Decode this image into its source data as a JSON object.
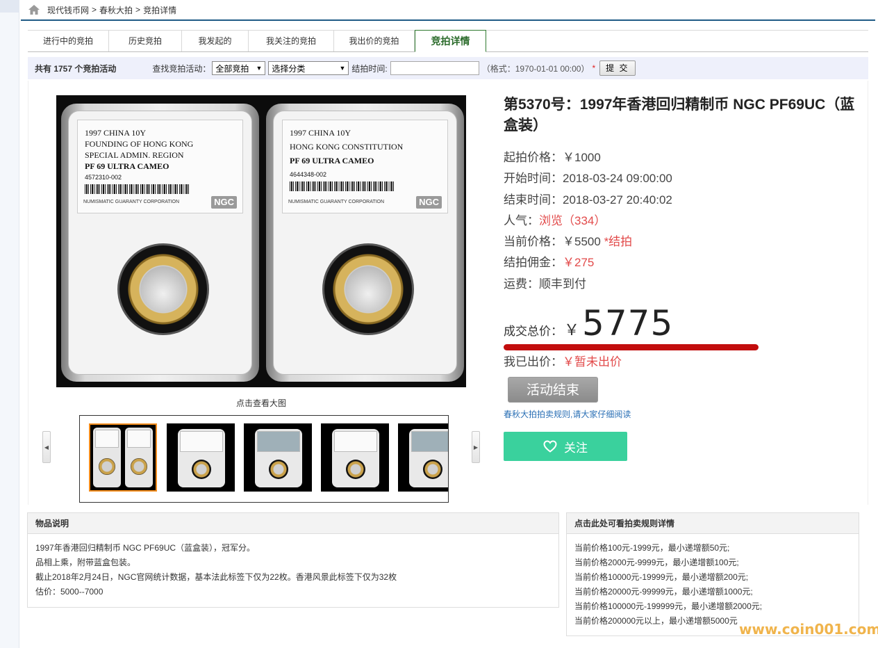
{
  "breadcrumb": {
    "items": [
      "现代钱币网",
      "春秋大拍",
      "竞拍详情"
    ],
    "separator": ">"
  },
  "tabs": [
    {
      "label": "进行中的竞拍",
      "active": false
    },
    {
      "label": "历史竞拍",
      "active": false
    },
    {
      "label": "我发起的",
      "active": false
    },
    {
      "label": "我关注的竞拍",
      "active": false
    },
    {
      "label": "我出价的竞拍",
      "active": false
    },
    {
      "label": "竞拍详情",
      "active": true
    }
  ],
  "filter": {
    "count_text": "共有 1757 个竞拍活动",
    "search_label": "查找竞拍活动：",
    "select_all": "全部竞拍",
    "select_category": "选择分类",
    "end_time_label": "结拍时间:",
    "end_time_value": "",
    "format_hint": "（格式：1970-01-01 00:00）",
    "required_mark": "*",
    "submit": "提 交"
  },
  "photo": {
    "slab_left": {
      "line1": "1997 CHINA 10Y",
      "line2": "FOUNDING OF HONG KONG",
      "line3": "SPECIAL ADMIN. REGION",
      "grade": "PF 69 ULTRA CAMEO",
      "cert": "4572310-002",
      "corp": "NUMISMATIC GUARANTY CORPORATION",
      "logo": "NGC"
    },
    "slab_right": {
      "line1": "1997 CHINA 10Y",
      "line2": "HONG KONG CONSTITUTION",
      "line3": "",
      "grade": "PF 69 ULTRA CAMEO",
      "cert": "4644348-002",
      "corp": "NUMISMATIC GUARANTY CORPORATION",
      "logo": "NGC"
    },
    "caption": "点击查看大图"
  },
  "item": {
    "title": "第5370号：1997年香港回归精制币 NGC PF69UC（蓝盒装）",
    "start_price_label": "起拍价格：",
    "start_price": "￥1000",
    "start_time_label": "开始时间：",
    "start_time": "2018-03-24 09:00:00",
    "end_time_label": "结束时间：",
    "end_time": "2018-03-27 20:40:02",
    "popularity_label": "人气：",
    "popularity_value": "浏览（334）",
    "current_price_label": "当前价格：",
    "current_price": "￥5500",
    "current_status": "*结拍",
    "commission_label": "结拍佣金：",
    "commission": "￥275",
    "shipping_label": "运费：",
    "shipping": "顺丰到付",
    "total_label": "成交总价：",
    "total_currency": "￥",
    "total_value": "5775",
    "my_bid_label": "我已出价：",
    "my_bid": "￥暂未出价",
    "ended_button": "活动结束",
    "rules_link": "春秋大拍拍卖规则,请大家仔细阅读",
    "follow_button": "关注"
  },
  "description": {
    "header": "物品说明",
    "lines": [
      "1997年香港回归精制币 NGC PF69UC（蓝盒装），冠军分。",
      "品相上乘，附带蓝盒包装。",
      "截止2018年2月24日，NGC官网统计数据，基本法此标签下仅为22枚。香港风景此标签下仅为32枚",
      "估价：5000--7000"
    ]
  },
  "rules": {
    "header": "点击此处可看拍卖规则详情",
    "lines": [
      "当前价格100元-1999元，最小递增额50元;",
      "当前价格2000元-9999元，最小递增额100元;",
      "当前价格10000元-19999元，最小递增额200元;",
      "当前价格20000元-99999元，最小递增额1000元;",
      "当前价格100000元-199999元，最小递增额2000元;",
      "当前价格200000元以上，最小递增额5000元"
    ]
  },
  "watermark": "www.coin001.com",
  "colors": {
    "active_tab": "#2b6b2b",
    "accent_red": "#e24a4a",
    "progress_bar": "#c20d0d",
    "follow_green": "#3ad19d",
    "link_blue": "#2a6fb5"
  }
}
